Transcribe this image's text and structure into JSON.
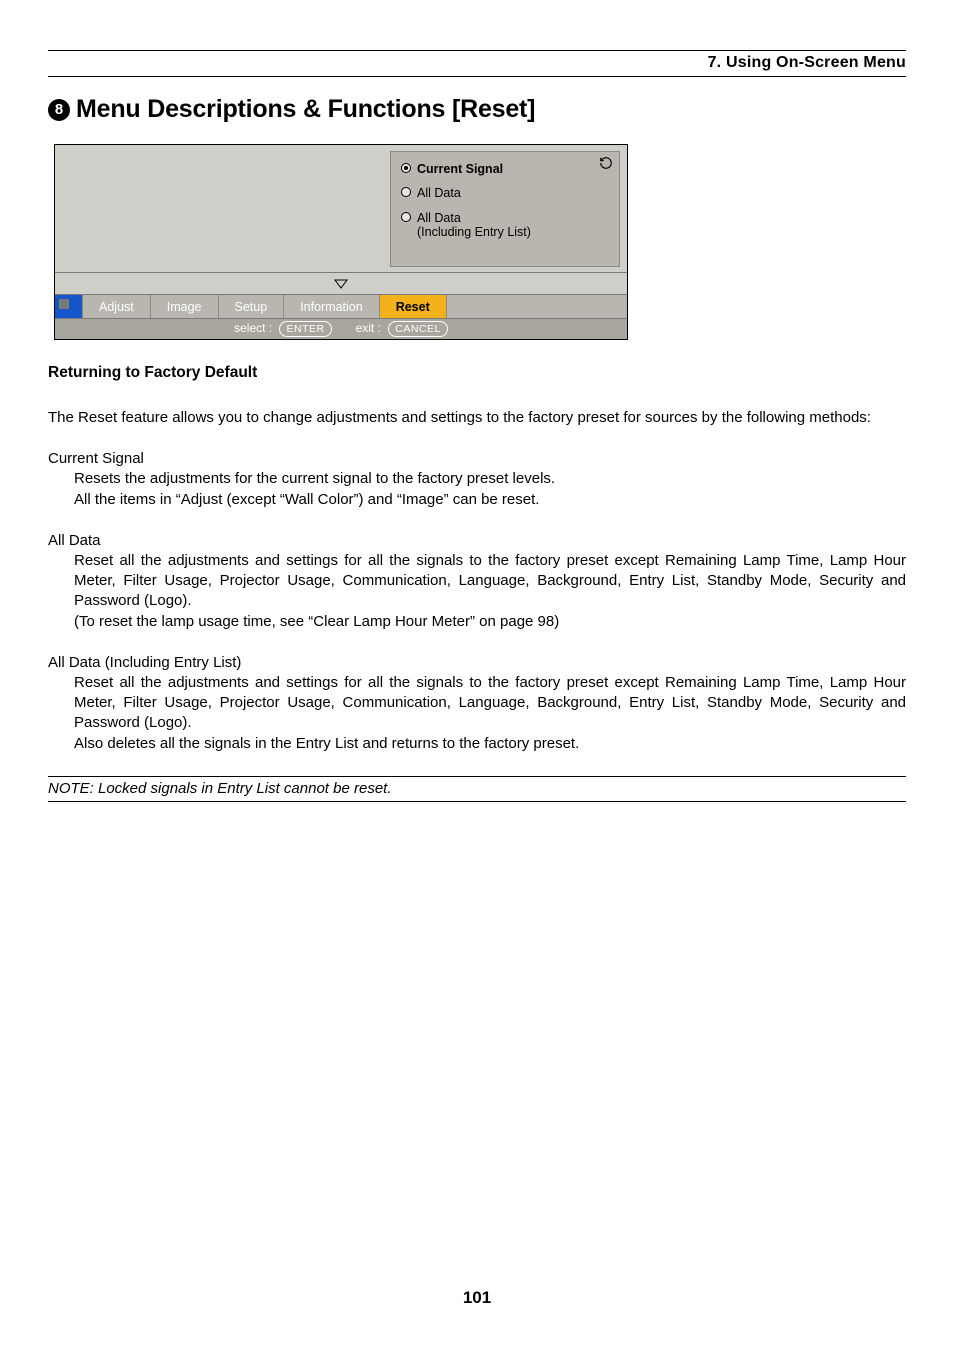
{
  "header": {
    "chapter": "7. Using On-Screen Menu"
  },
  "section": {
    "number": "8",
    "title": "Menu Descriptions & Functions [Reset]"
  },
  "osd": {
    "options": {
      "0": {
        "label": "Current Signal",
        "selected": true
      },
      "1": {
        "label": "All Data",
        "selected": false
      },
      "2": {
        "label_line1": "All Data",
        "label_line2": "(Including Entry List)",
        "selected": false
      }
    },
    "tabs": {
      "0": "Adjust",
      "1": "Image",
      "2": "Setup",
      "3": "Information",
      "4": "Reset"
    },
    "footer": {
      "select_label": "select :",
      "select_key": "ENTER",
      "exit_label": "exit :",
      "exit_key": "CANCEL"
    }
  },
  "content": {
    "subheading": "Returning to Factory Default",
    "intro": "The Reset feature allows you to change adjustments and settings to the factory preset for sources by the following methods:",
    "defs": {
      "0": {
        "title": "Current Signal",
        "body": "Resets the adjustments for the current signal to the factory preset levels.\nAll the items in “Adjust (except “Wall Color”) and “Image” can be reset."
      },
      "1": {
        "title": "All Data",
        "body": "Reset all the adjustments and settings for all the signals to the factory preset except Remaining Lamp Time, Lamp Hour Meter, Filter Usage, Projector Usage, Communication, Language, Background, Entry List, Standby Mode, Security and Password (Logo).\n(To reset the lamp usage time, see “Clear Lamp Hour Meter” on page 98)"
      },
      "2": {
        "title": "All Data (Including Entry List)",
        "body": "Reset all the adjustments and settings for all the signals to the factory preset except Remaining Lamp Time, Lamp Hour Meter, Filter Usage, Projector Usage, Communication, Language, Background, Entry List, Standby Mode, Security and Password (Logo).\nAlso deletes all the signals in the Entry List and returns to the factory preset."
      }
    },
    "note": "NOTE: Locked signals in Entry List cannot be reset."
  },
  "page_number": "101"
}
